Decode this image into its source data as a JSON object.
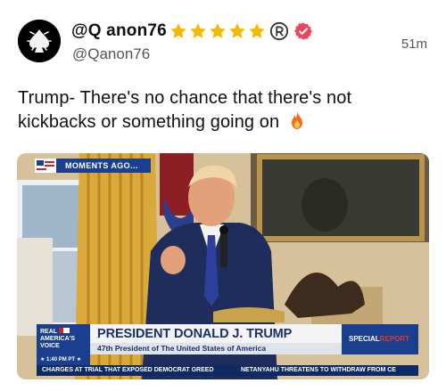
{
  "post": {
    "display_name": "@Q anon76",
    "handle": "@Qanon76",
    "time": "51m",
    "star_count": 5,
    "text": "Trump- There's no chance that there's not kickbacks or something going on",
    "text_emoji_icon": "fire-icon",
    "colors": {
      "star": "#f5b800",
      "verified": "#f0445c",
      "brand_blue": "#1b3f8f"
    }
  },
  "broadcast": {
    "banner": "MOMENTS AGO...",
    "network_logo_line1": "REAL",
    "network_logo_line2": "AMERICA'S",
    "network_logo_line3": "VOICE",
    "time_stamp": "★ 1:40 PM PT ★",
    "name_plate": "PRESIDENT DONALD J. TRUMP",
    "name_sub": "47th President of The United States of America",
    "special": "SPECIAL",
    "report": "REPORT",
    "ticker_left": "CHARGES AT TRIAL THAT EXPOSED DEMOCRAT GREED",
    "ticker_right": "NETANYAHU THREATENS TO WITHDRAW FROM CE"
  }
}
